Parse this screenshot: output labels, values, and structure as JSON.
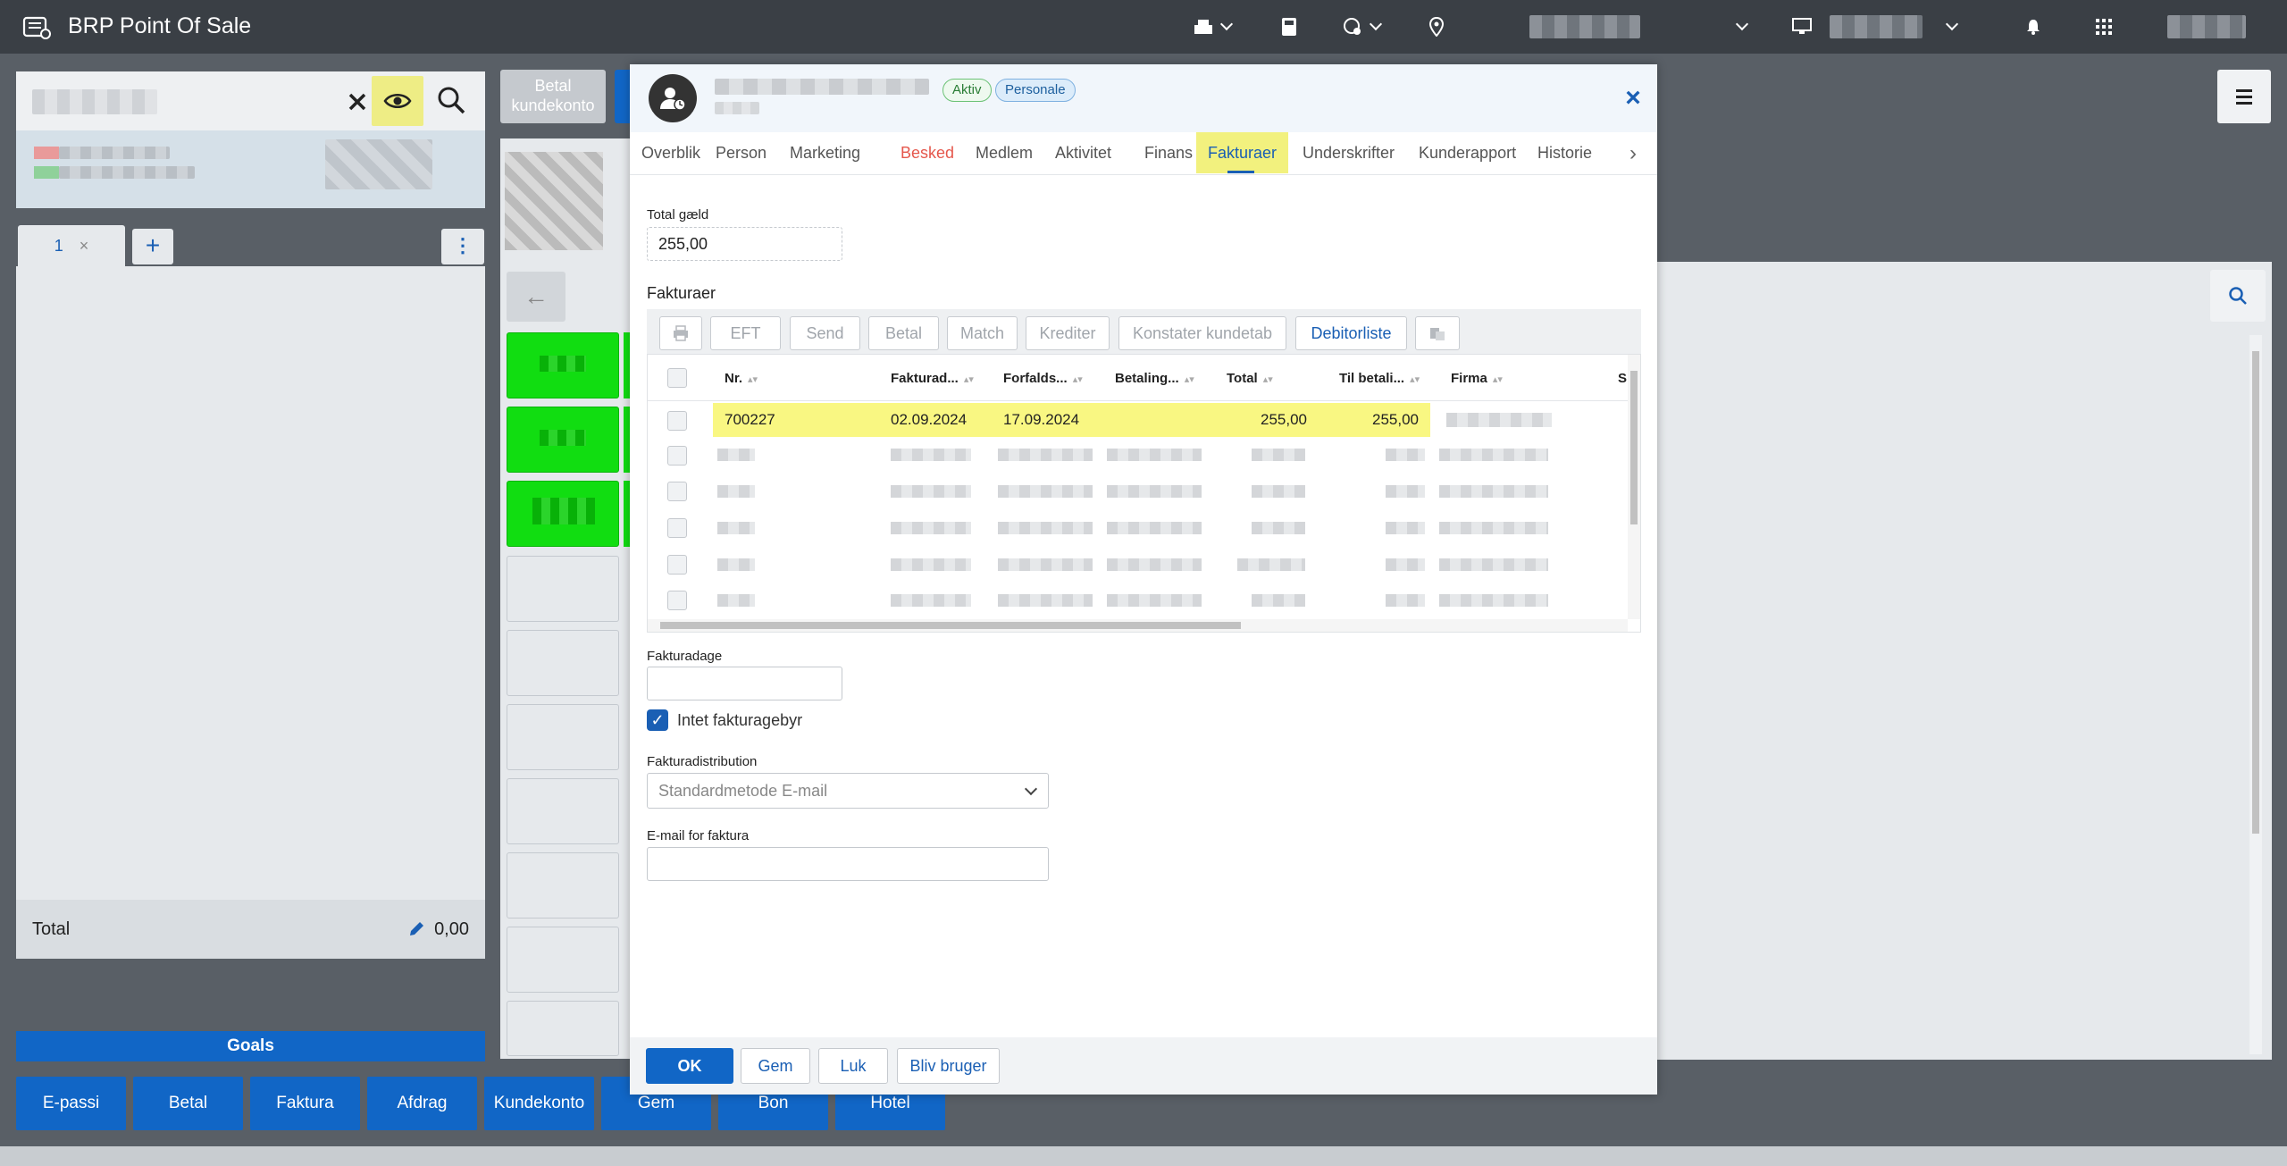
{
  "app": {
    "title": "BRP Point Of Sale"
  },
  "topbar": {
    "icons": [
      "register-icon",
      "calculator-icon",
      "globe-settings-icon",
      "location-pin-icon",
      "monitor-icon",
      "bell-icon",
      "apps-grid-icon"
    ]
  },
  "search": {
    "clear_icon": "close-icon",
    "eye_icon": "eye-icon",
    "search_icon": "search-icon"
  },
  "basket": {
    "tab_label": "1",
    "tab_close": "×",
    "add": "+",
    "more": "⋮",
    "total_label": "Total",
    "total_value": "0,00"
  },
  "goals": "Goals",
  "bottom_buttons": [
    "E-passi",
    "Betal",
    "Faktura",
    "Afdrag",
    "Kundekonto",
    "Gem",
    "Bon",
    "Hotel"
  ],
  "middle": {
    "pay_account_label": "Betal kundekonto",
    "back": "←"
  },
  "modal": {
    "badges": {
      "active": "Aktiv",
      "staff": "Personale"
    },
    "close": "×",
    "tabs": [
      "Overblik",
      "Person",
      "Marketing",
      "Besked",
      "Medlem",
      "Aktivitet",
      "Finans",
      "Fakturaer",
      "Underskrifter",
      "Kunderapport",
      "Historie"
    ],
    "active_tab": "Fakturaer",
    "total_debt_label": "Total gæld",
    "total_debt_value": "255,00",
    "invoices_title": "Fakturaer",
    "toolbar": [
      "EFT",
      "Send",
      "Betal",
      "Match",
      "Krediter",
      "Konstater kundetab",
      "Debitorliste"
    ],
    "columns": [
      "Nr.",
      "Fakturad...",
      "Forfalds...",
      "Betaling...",
      "Total",
      "Til betali...",
      "Firma",
      "S"
    ],
    "rows": [
      {
        "nr": "700227",
        "invoice_date": "02.09.2024",
        "due_date": "17.09.2024",
        "payment": "",
        "total": "255,00",
        "to_pay": "255,00"
      }
    ],
    "invoice_days_label": "Fakturadage",
    "invoice_days_value": "",
    "no_fee_label": "Intet fakturagebyr",
    "no_fee_checked": true,
    "distribution_label": "Fakturadistribution",
    "distribution_value": "Standardmetode E-mail",
    "email_label": "E-mail for faktura",
    "email_value": "",
    "footer": {
      "ok": "OK",
      "save": "Gem",
      "close": "Luk",
      "become_user": "Bliv bruger"
    }
  },
  "colors": {
    "accent": "#1166c6",
    "highlight": "#f9f782",
    "topbar": "#3a3f45",
    "green_tile": "#11dd11",
    "warn": "#e5574c"
  }
}
